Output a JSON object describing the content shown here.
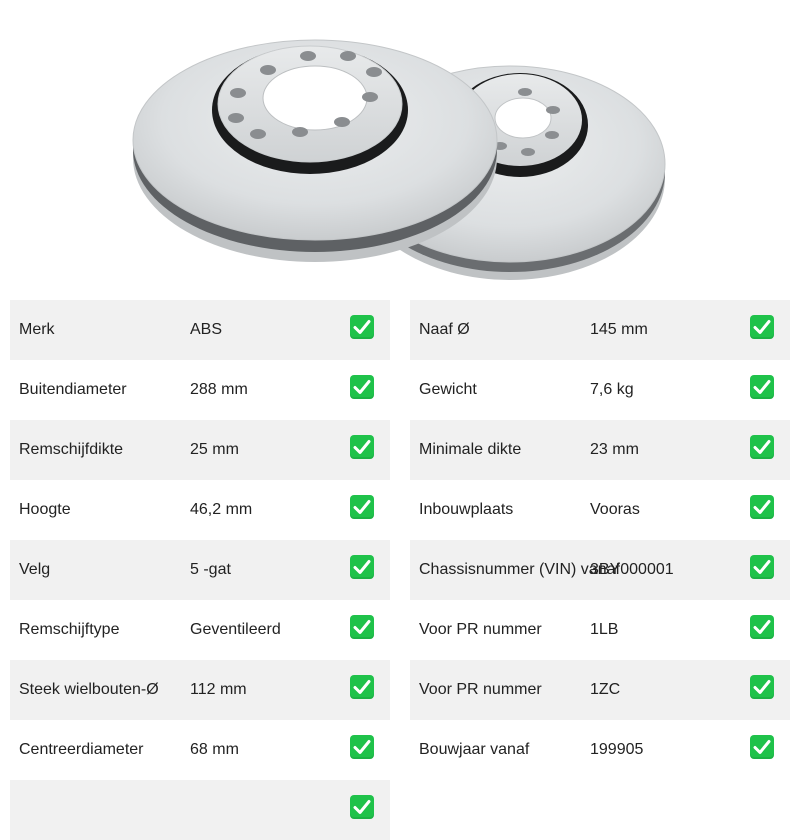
{
  "colors": {
    "check_green": "#1fc24a",
    "row_shade": "#f1f1f1",
    "text": "#222222"
  },
  "hero": {
    "image": "brake-discs-pair"
  },
  "specs_left": [
    {
      "label": "Merk",
      "value": "ABS",
      "icon": "check-icon"
    },
    {
      "label": "Buitendiameter",
      "value": "288 mm",
      "icon": "check-icon"
    },
    {
      "label": "Remschijfdikte",
      "value": "25 mm",
      "icon": "check-icon"
    },
    {
      "label": "Hoogte",
      "value": "46,2 mm",
      "icon": "check-icon"
    },
    {
      "label": "Velg",
      "value": "5 -gat",
      "icon": "check-icon"
    },
    {
      "label": "Remschijftype",
      "value": "Geventileerd",
      "icon": "check-icon"
    },
    {
      "label": "Steek wielbouten-Ø",
      "value": "112 mm",
      "icon": "check-icon"
    },
    {
      "label": "Centreerdiameter",
      "value": "68 mm",
      "icon": "check-icon"
    },
    {
      "label": "",
      "value": "",
      "icon": "check-icon"
    }
  ],
  "specs_right": [
    {
      "label": "Naaf Ø",
      "value": "145 mm",
      "icon": "check-icon"
    },
    {
      "label": "Gewicht",
      "value": "7,6 kg",
      "icon": "check-icon"
    },
    {
      "label": "Minimale dikte",
      "value": "23 mm",
      "icon": "check-icon"
    },
    {
      "label": "Inbouwplaats",
      "value": "Vooras",
      "icon": "check-icon"
    },
    {
      "label": "Chassisnummer (VIN) vanaf",
      "value": "3BY000001",
      "icon": "check-icon"
    },
    {
      "label": "Voor PR nummer",
      "value": "1LB",
      "icon": "check-icon"
    },
    {
      "label": "Voor PR nummer",
      "value": "1ZC",
      "icon": "check-icon"
    },
    {
      "label": "Bouwjaar vanaf",
      "value": "199905",
      "icon": "check-icon"
    }
  ]
}
